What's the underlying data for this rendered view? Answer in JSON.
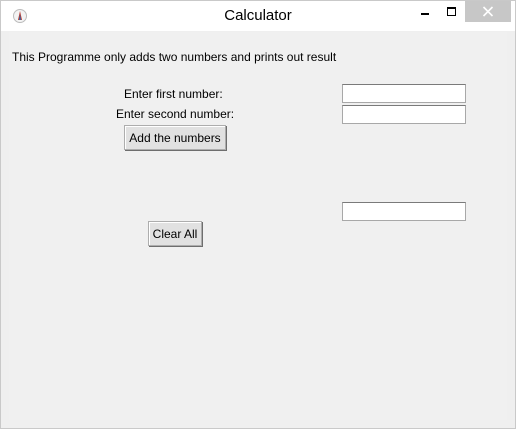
{
  "window": {
    "title": "Calculator",
    "close_button_color": "#c7c7c7"
  },
  "icons": {
    "app": "feather-icon",
    "minimize": "minimize-icon",
    "maximize": "maximize-icon",
    "close": "close-icon"
  },
  "main": {
    "description": "This Programme only adds two numbers and prints out result",
    "first_label": "Enter first number:",
    "second_label": "Enter second number:",
    "first_value": "",
    "second_value": "",
    "add_button": "Add the numbers",
    "result_value": "",
    "clear_button": "Clear All"
  }
}
